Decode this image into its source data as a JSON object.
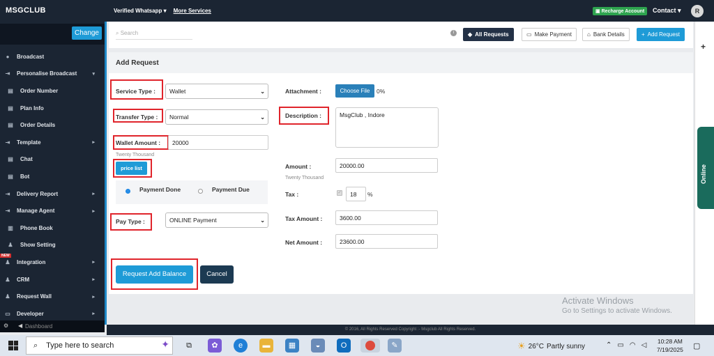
{
  "topbar": {
    "brand": "MSGCLUB",
    "nav_verified": "Verified Whatsapp",
    "nav_more": "More Services",
    "recharge": "Recharge Account",
    "contact": "Contact",
    "avatar": "R"
  },
  "sidebar": {
    "change": "Change",
    "items": [
      {
        "label": "Broadcast",
        "icon": "broadcast-icon"
      },
      {
        "label": "Personalise Broadcast",
        "icon": "import-icon",
        "arrow": "▾"
      },
      {
        "label": "Order Number",
        "icon": "document-icon"
      },
      {
        "label": "Plan Info",
        "icon": "document-icon"
      },
      {
        "label": "Order Details",
        "icon": "document-icon"
      },
      {
        "label": "Template",
        "icon": "import-icon",
        "arrow": "▸"
      },
      {
        "label": "Chat",
        "icon": "document-icon"
      },
      {
        "label": "Bot",
        "icon": "document-icon"
      },
      {
        "label": "Delivery Report",
        "icon": "import-icon",
        "arrow": "▸"
      },
      {
        "label": "Manage Agent",
        "icon": "import-icon",
        "arrow": "▸"
      },
      {
        "label": "Phone Book",
        "icon": "phonebook-icon"
      },
      {
        "label": "Show Setting",
        "icon": "users-icon"
      },
      {
        "label": "Integration",
        "icon": "users-icon",
        "arrow": "▸",
        "badge": "NEW"
      },
      {
        "label": "CRM",
        "icon": "users-icon",
        "arrow": "▸"
      },
      {
        "label": "Request Wall",
        "icon": "users-icon",
        "arrow": "▸"
      },
      {
        "label": "Developer",
        "icon": "monitor-icon",
        "arrow": "▸"
      }
    ],
    "bottom": "Dashboard"
  },
  "toolbar": {
    "search_placeholder": "Search",
    "all_requests": "All Requests",
    "make_payment": "Make Payment",
    "bank_details": "Bank Details",
    "add_request": "Add Request"
  },
  "online": "Online",
  "form": {
    "title": "Add Request",
    "service_type_label": "Service Type :",
    "service_type_value": "Wallet",
    "transfer_type_label": "Transfer Type :",
    "transfer_type_value": "Normal",
    "wallet_amount_label": "Wallet Amount :",
    "wallet_amount_value": "20000",
    "wallet_amount_words": "Twenty Thousand",
    "price_list": "price list",
    "payment_done": "Payment Done",
    "payment_due": "Payment Due",
    "pay_type_label": "Pay Type :",
    "pay_type_value": "ONLINE Payment",
    "attachment_label": "Attachment :",
    "choose_file": "Choose File",
    "upload_progress": "0%",
    "description_label": "Description :",
    "description_value": "MsgClub , Indore",
    "amount_label": "Amount :",
    "amount_value": "20000.00",
    "amount_words": "Twenty Thousand",
    "tax_label": "Tax :",
    "tax_value": "18",
    "tax_unit": "%",
    "tax_amount_label": "Tax Amount :",
    "tax_amount_value": "3600.00",
    "net_amount_label": "Net Amount :",
    "net_amount_value": "23600.00",
    "request_button": "Request Add Balance",
    "cancel_button": "Cancel"
  },
  "watermark": {
    "line1": "Activate Windows",
    "line2": "Go to Settings to activate Windows."
  },
  "footer": "© 2016, All Rights Reserved Copyright :- Msgclub All Rights Reserved.",
  "taskbar": {
    "search_placeholder": "Type here to search",
    "weather_temp": "26°C",
    "weather_text": "Partly sunny",
    "time": "10:28 AM",
    "date": "7/19/2025"
  },
  "colors": {
    "sidebar_bg": "#1b2533",
    "accent_blue": "#1e9bd7",
    "highlight_red": "#e0242b",
    "recharge_green": "#2ea44f"
  }
}
